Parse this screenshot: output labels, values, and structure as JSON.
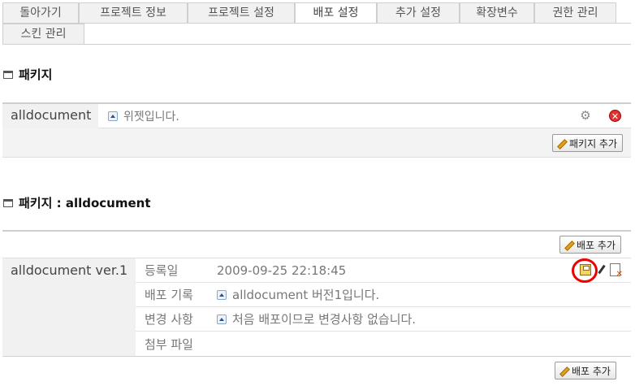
{
  "tabs": [
    {
      "label": "돌아가기",
      "active": false
    },
    {
      "label": "프로젝트 정보",
      "active": false
    },
    {
      "label": "프로젝트 설정",
      "active": false
    },
    {
      "label": "배포 설정",
      "active": true
    },
    {
      "label": "추가 설정",
      "active": false
    },
    {
      "label": "확장변수",
      "active": false
    },
    {
      "label": "권한 관리",
      "active": false
    },
    {
      "label": "스킨 관리",
      "active": false
    }
  ],
  "package_section": {
    "title": "패키지",
    "package": {
      "name": "alldocument",
      "description": "위젯입니다."
    },
    "add_button": "패키지 추가"
  },
  "release_section": {
    "title": "패키지 : alldocument",
    "add_button_top": "배포 추가",
    "release": {
      "name": "alldocument ver.1",
      "rows": [
        {
          "label": "등록일",
          "value": "2009-09-25 22:18:45"
        },
        {
          "label": "배포 기록",
          "value": "alldocument 버전1입니다."
        },
        {
          "label": "변경 사항",
          "value": "처음 배포이므로 변경사항 없습니다."
        },
        {
          "label": "첨부 파일",
          "value": ""
        }
      ]
    },
    "add_button_bottom": "배포 추가"
  },
  "icons": {
    "gear": "gear-icon",
    "delete": "delete-icon",
    "expand": "expand-icon",
    "save": "save-icon",
    "edit": "pencil-icon",
    "remove_release": "document-delete-icon"
  },
  "colors": {
    "highlight": "#e00000",
    "delete": "#dd3333"
  }
}
